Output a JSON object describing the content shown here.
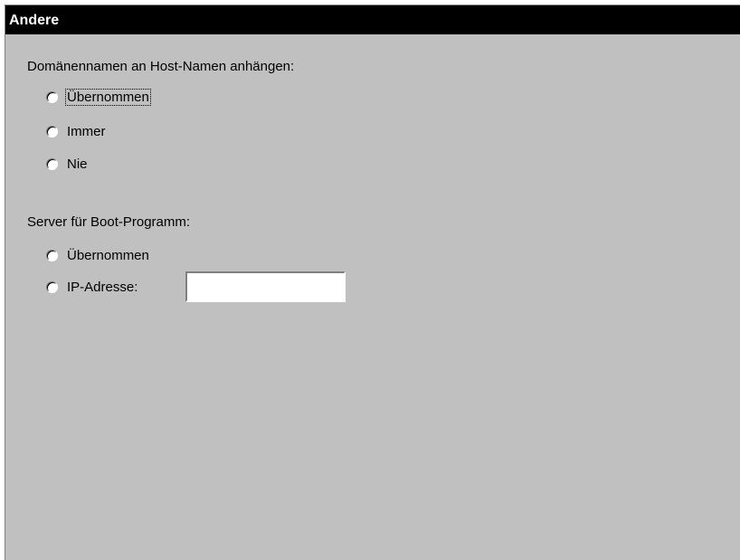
{
  "panel": {
    "title": "Andere"
  },
  "domain_group": {
    "label": "Domänennamen an Host-Namen anhängen:",
    "options": [
      {
        "label": "Übernommen"
      },
      {
        "label": "Immer"
      },
      {
        "label": "Nie"
      }
    ],
    "selected": null
  },
  "boot_group": {
    "label": "Server für Boot-Programm:",
    "options": [
      {
        "label": "Übernommen"
      },
      {
        "label": "IP-Adresse:"
      }
    ],
    "selected": null,
    "ip_value": ""
  }
}
